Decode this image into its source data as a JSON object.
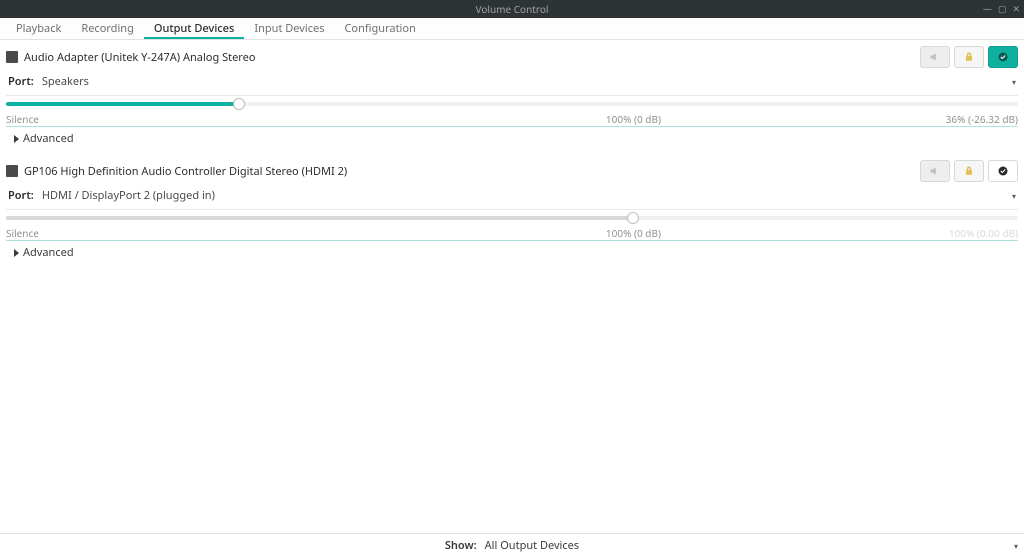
{
  "window": {
    "title": "Volume Control"
  },
  "tabs": [
    {
      "label": "Playback",
      "active": false
    },
    {
      "label": "Recording",
      "active": false
    },
    {
      "label": "Output Devices",
      "active": true
    },
    {
      "label": "Input Devices",
      "active": false
    },
    {
      "label": "Configuration",
      "active": false
    }
  ],
  "labels": {
    "port": "Port:",
    "advanced": "Advanced",
    "silence": "Silence"
  },
  "devices": [
    {
      "name": "Audio Adapter (Unitek Y-247A) Analog Stereo",
      "port": "Speakers",
      "volume_percent": 36,
      "base_percent": 62,
      "mid_label": "100% (0 dB)",
      "right_label": "36% (-26.32 dB)",
      "is_default": true
    },
    {
      "name": "GP106 High Definition Audio Controller Digital Stereo (HDMI 2)",
      "port": "HDMI / DisplayPort 2 (plugged in)",
      "volume_percent": 62,
      "base_percent": 62,
      "mid_label": "100% (0 dB)",
      "right_label": "100% (0.00 dB)",
      "is_default": false
    }
  ],
  "footer": {
    "show_label": "Show:",
    "show_value": "All Output Devices"
  }
}
